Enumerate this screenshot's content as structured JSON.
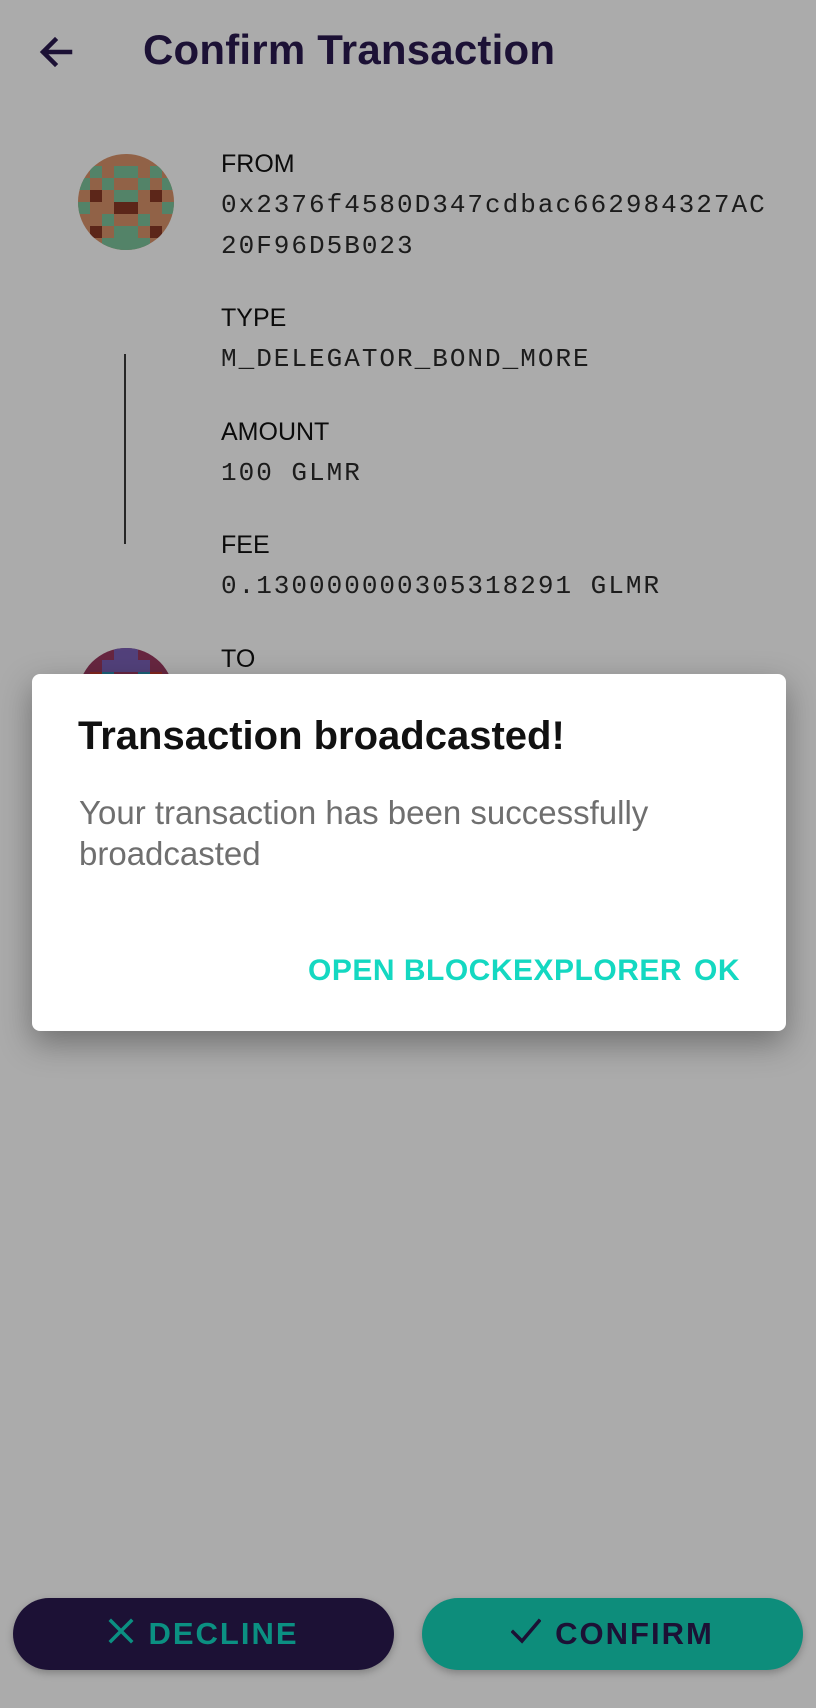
{
  "header": {
    "title": "Confirm Transaction",
    "back_icon": "arrow-left-icon"
  },
  "transaction": {
    "from_label": "FROM",
    "from_address": "0x2376f4580D347cdbac662984327AC20F96D5B023",
    "type_label": "TYPE",
    "type_value": "M_DELEGATOR_BOND_MORE",
    "amount_label": "AMOUNT",
    "amount_value": "100 GLMR",
    "fee_label": "FEE",
    "fee_value": "0.130000000305318291 GLMR",
    "to_label": "TO"
  },
  "actions": {
    "decline_label": "DECLINE",
    "confirm_label": "CONFIRM"
  },
  "dialog": {
    "title": "Transaction broadcasted!",
    "message": "Your transaction has been successfully broadcasted",
    "explorer_label": "OPEN BLOCKEXPLORER",
    "ok_label": "OK"
  },
  "colors": {
    "primary_dark": "#2b1a4f",
    "accent_teal": "#14d2b8"
  }
}
